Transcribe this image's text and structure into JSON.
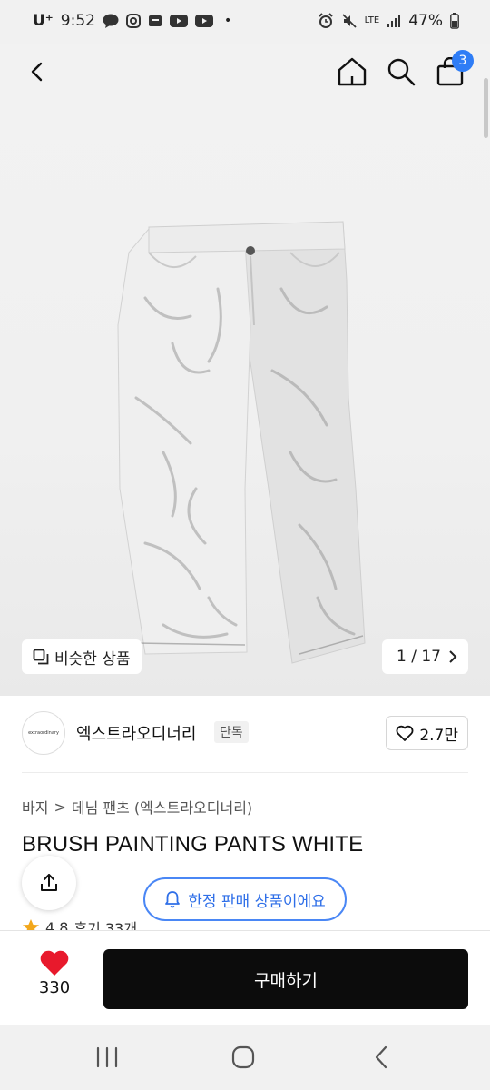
{
  "status_bar": {
    "carrier": "U⁺",
    "time": "9:52",
    "dot": "•",
    "network": "LTE",
    "battery": "47%",
    "icons": [
      "talk-icon",
      "instagram-icon",
      "app-icon",
      "youtube-icon",
      "youtube-icon",
      "alarm-icon",
      "mute-icon",
      "signal-icon",
      "battery-icon"
    ]
  },
  "header": {
    "cart_count": "3",
    "icons": [
      "back-icon",
      "home-icon",
      "search-icon",
      "bag-icon"
    ]
  },
  "gallery": {
    "similar_label": "비슷한 상품",
    "pager_text": "1 / 17",
    "image_subject": "white brush-painted pants"
  },
  "brand": {
    "logo_text": "extraordinary",
    "name": "엑스트라오디너리",
    "tag": "단독",
    "like_count": "2.7만"
  },
  "breadcrumb": {
    "category": "바지",
    "separator": ">",
    "subcategory": "데님 팬츠 (엑스트라오디너리)"
  },
  "product": {
    "title": "BRUSH PAINTING PANTS WHITE",
    "rating": "4.8",
    "reviews": "후기 33개"
  },
  "notice": {
    "limited_label": "한정 판매 상품이에요"
  },
  "purchase": {
    "wish_count": "330",
    "buy_label": "구매하기"
  },
  "colors": {
    "accent_blue": "#2f7df6",
    "heart_red": "#e8192c",
    "buy_black": "#0c0c0c",
    "star_orange": "#f2a71b"
  }
}
